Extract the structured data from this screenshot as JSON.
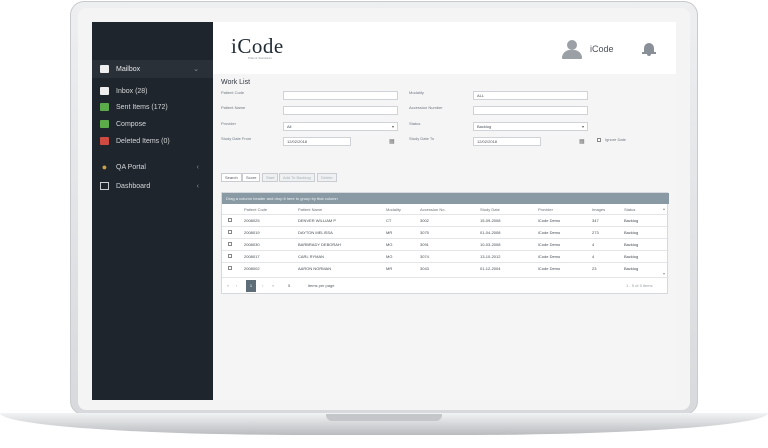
{
  "header": {
    "logo": "iCode",
    "logo_sub": "Patient Standards",
    "username": "iCode"
  },
  "sidebar": {
    "mailbox": "Mailbox",
    "items": [
      {
        "label": "Inbox (28)",
        "icon": "inbox-icon"
      },
      {
        "label": "Sent Items (172)",
        "icon": "sent-icon"
      },
      {
        "label": "Compose",
        "icon": "compose-icon"
      },
      {
        "label": "Deleted Items (0)",
        "icon": "trash-icon"
      }
    ],
    "qa_portal": "QA Portal",
    "dashboard": "Dashboard"
  },
  "worklist": {
    "title": "Work List",
    "patient_code_label": "Patient Code",
    "patient_name_label": "Patient Name",
    "provider_label": "Provider",
    "provider_value": "All",
    "study_date_from_label": "Study Date From",
    "study_date_from_value": "12/02/2018",
    "modality_label": "Modality",
    "modality_value": "ALL",
    "accession_label": "Accession Number",
    "status_label": "Status",
    "status_value": "Backlog",
    "study_date_to_label": "Study Date To",
    "study_date_to_value": "12/02/2018",
    "ignore_date_label": "Ignore Date"
  },
  "buttons": {
    "search": "Search",
    "score": "Score",
    "start": "Start",
    "add_to_backlog": "Add To Backlog",
    "delete": "Delete"
  },
  "grid": {
    "group_hint": "Drag a column header and drop it here to group by that column",
    "columns": [
      "Patient Code",
      "Patient Name",
      "Modality",
      "Accession No.",
      "Study Date",
      "Provider",
      "Images",
      "Status"
    ],
    "rows": [
      [
        "2008025",
        "DENVER WILLIAM P",
        "CT",
        "3002",
        "15-09-2008",
        "iCode Demo",
        "347",
        "Backlog"
      ],
      [
        "2008019",
        "DAYTON MELISSA",
        "MR",
        "3075",
        "01-04-2008",
        "iCode Demo",
        "273",
        "Backlog"
      ],
      [
        "2008030",
        "BARBRADY DEBORAH",
        "MG",
        "3091",
        "10-03-2008",
        "iCode Demo",
        "4",
        "Backlog"
      ],
      [
        "2008017",
        "CARL RYMAN",
        "MG",
        "3074",
        "13-10-2012",
        "iCode Demo",
        "4",
        "Backlog"
      ],
      [
        "2008002",
        "AARON NORMAN",
        "MR",
        "3043",
        "01-12-2004",
        "iCode Demo",
        "23",
        "Backlog"
      ]
    ],
    "page_current": "1",
    "page_size": "5",
    "items_per_page": "items per page",
    "range": "1 - 5 of 5 items"
  },
  "colors": {
    "sidebar_bg": "#1f252c",
    "group_bar": "#8a9aa5",
    "accent_green": "#5cab4a",
    "accent_red": "#cf4b41"
  }
}
